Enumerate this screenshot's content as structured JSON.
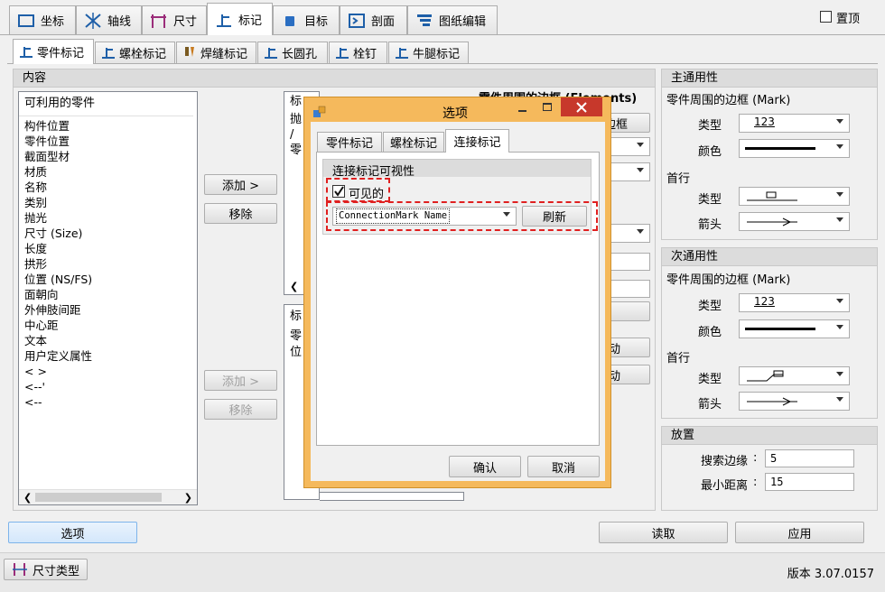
{
  "top_tabs": [
    {
      "label": "坐标",
      "icon": "coordinate-icon"
    },
    {
      "label": "轴线",
      "icon": "axis-icon"
    },
    {
      "label": "尺寸",
      "icon": "dimension-icon"
    },
    {
      "label": "标记",
      "icon": "mark-icon"
    },
    {
      "label": "目标",
      "icon": "target-icon"
    },
    {
      "label": "剖面",
      "icon": "section-icon"
    },
    {
      "label": "图纸编辑",
      "icon": "drawing-edit-icon"
    }
  ],
  "topmost_label": "置顶",
  "sub_tabs": [
    {
      "label": "零件标记"
    },
    {
      "label": "螺栓标记"
    },
    {
      "label": "焊缝标记"
    },
    {
      "label": "长圆孔"
    },
    {
      "label": "栓钉"
    },
    {
      "label": "牛腿标记"
    }
  ],
  "content": {
    "header": "内容",
    "available_title": "可利用的零件",
    "available_items": [
      "构件位置",
      "零件位置",
      "截面型材",
      "材质",
      "名称",
      "类别",
      "抛光",
      "尺寸 (Size)",
      "长度",
      "拱形",
      "位置 (NS/FS)",
      "面朝向",
      "外伸肢间距",
      "中心距",
      "文本",
      "用户定义属性",
      "< >",
      "<--'",
      "<--"
    ],
    "add_label": "添加 >",
    "remove_label": "移除",
    "add2_label": "添加 >",
    "remove2_label": "移除",
    "mid_list1_partial": [
      "标",
      "抛",
      "/",
      "零"
    ],
    "mid_list2_partial": [
      "标",
      "零",
      "位"
    ],
    "elements_frame_title": "零件周围的边框 (Elements)",
    "frame_btn_partial": "边框",
    "move_btn1_partial": "动",
    "move_btn2_partial": "动"
  },
  "main_props": {
    "title": "主通用性",
    "frame_label": "零件周围的边框 (Mark)",
    "type_label": "类型",
    "type_value": "123",
    "color_label": "颜色",
    "head_label": "首行",
    "head_type_label": "类型",
    "arrow_label": "箭头"
  },
  "sub_props": {
    "title": "次通用性",
    "frame_label": "零件周围的边框 (Mark)",
    "type_label": "类型",
    "type_value": "123",
    "color_label": "颜色",
    "head_label": "首行",
    "head_type_label": "类型",
    "arrow_label": "箭头"
  },
  "placement": {
    "title": "放置",
    "search_margin_label": "搜索边缘",
    "search_margin_value": "5",
    "min_distance_label": "最小距离",
    "min_distance_value": "15"
  },
  "bottom": {
    "options_label": "选项",
    "read_label": "读取",
    "apply_label": "应用"
  },
  "status": {
    "dim_type_label": "尺寸类型",
    "version": "版本 3.07.0157"
  },
  "dialog": {
    "title": "选项",
    "tabs": [
      "零件标记",
      "螺栓标记",
      "连接标记"
    ],
    "active_tab": 2,
    "group_title": "连接标记可视性",
    "visible_label": "可见的",
    "visible_checked": true,
    "combo_value": "ConnectionMark Name",
    "refresh_label": "刷新",
    "ok_label": "确认",
    "cancel_label": "取消",
    "accent_color": "#f5b95c",
    "close_color": "#c7382b"
  }
}
